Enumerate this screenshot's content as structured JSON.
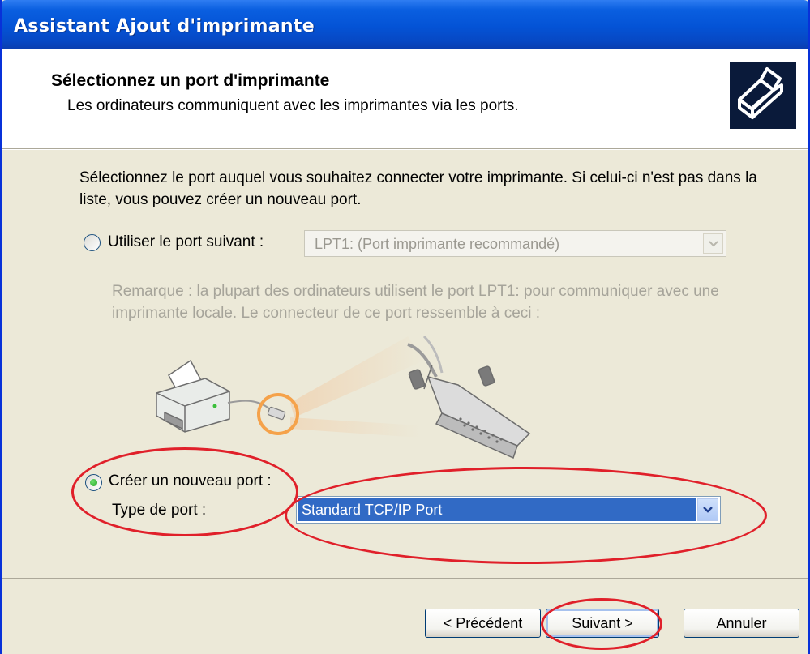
{
  "window": {
    "title": "Assistant Ajout d'imprimante"
  },
  "header": {
    "title": "Sélectionnez un port d'imprimante",
    "subtitle": "Les ordinateurs communiquent avec les imprimantes via les ports.",
    "icon": "printer-wizard-icon"
  },
  "body": {
    "intro": "Sélectionnez le port auquel vous souhaitez connecter votre imprimante. Si celui-ci n'est pas dans la liste, vous pouvez créer un nouveau port.",
    "use_port": {
      "label": "Utiliser le port suivant :",
      "selected": false,
      "combo_value": "LPT1: (Port imprimante recommandé)"
    },
    "note": "Remarque : la plupart des ordinateurs utilisent le port LPT1: pour communiquer avec une imprimante locale. Le connecteur de ce port ressemble à ceci :",
    "illustration": "printer-lpt-connector-illustration",
    "create_port": {
      "label": "Créer un nouveau port :",
      "selected": true,
      "type_label": "Type de port :",
      "combo_value": "Standard TCP/IP Port"
    }
  },
  "footer": {
    "back_label": "< Précédent",
    "next_label": "Suivant >",
    "cancel_label": "Annuler"
  },
  "colors": {
    "annotation": "#e0202a",
    "selection": "#316ac5",
    "titlebar": "#0453d6"
  }
}
